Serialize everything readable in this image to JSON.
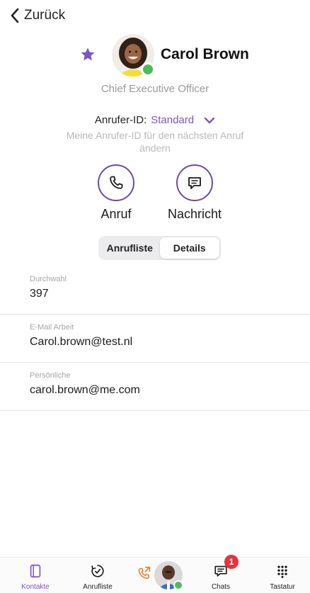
{
  "nav": {
    "back_label": "Zurück"
  },
  "contact": {
    "name": "Carol Brown",
    "job_title": "Chief Executive Officer",
    "favorite": true,
    "presence": "online"
  },
  "caller_id": {
    "label": "Anrufer-ID:",
    "value": "Standard",
    "hint": "Meine Anrufer-ID für den nächsten Anruf ändern"
  },
  "actions": {
    "call_label": "Anruf",
    "message_label": "Nachricht"
  },
  "segmented": {
    "calls_label": "Anrufliste",
    "details_label": "Details",
    "selected": "Details"
  },
  "fields": [
    {
      "label": "Durchwahl",
      "value": "397"
    },
    {
      "label": "E-Mail Arbeit",
      "value": "Carol.brown@test.nl"
    },
    {
      "label": "Persönliche",
      "value": "carol.brown@me.com"
    }
  ],
  "tabbar": {
    "contacts_label": "Kontakte",
    "calls_label": "Anrufliste",
    "chats_label": "Chats",
    "chats_badge": "1",
    "keypad_label": "Tastatur",
    "active": "Kontakte"
  },
  "colors": {
    "accent": "#7b55c7",
    "online": "#4cbc5a",
    "badge": "#e5333c",
    "missed_call": "#e8823a"
  },
  "icons": {
    "back": "chevron-left-icon",
    "favorite": "star-icon",
    "caller_id_toggle": "chevron-down-icon",
    "call": "phone-icon",
    "message": "chat-bubble-icon",
    "contacts": "contacts-book-icon",
    "call_history": "clock-check-icon",
    "missed_call": "incoming-call-icon",
    "chats": "chat-bubble-icon",
    "keypad": "keypad-icon"
  }
}
